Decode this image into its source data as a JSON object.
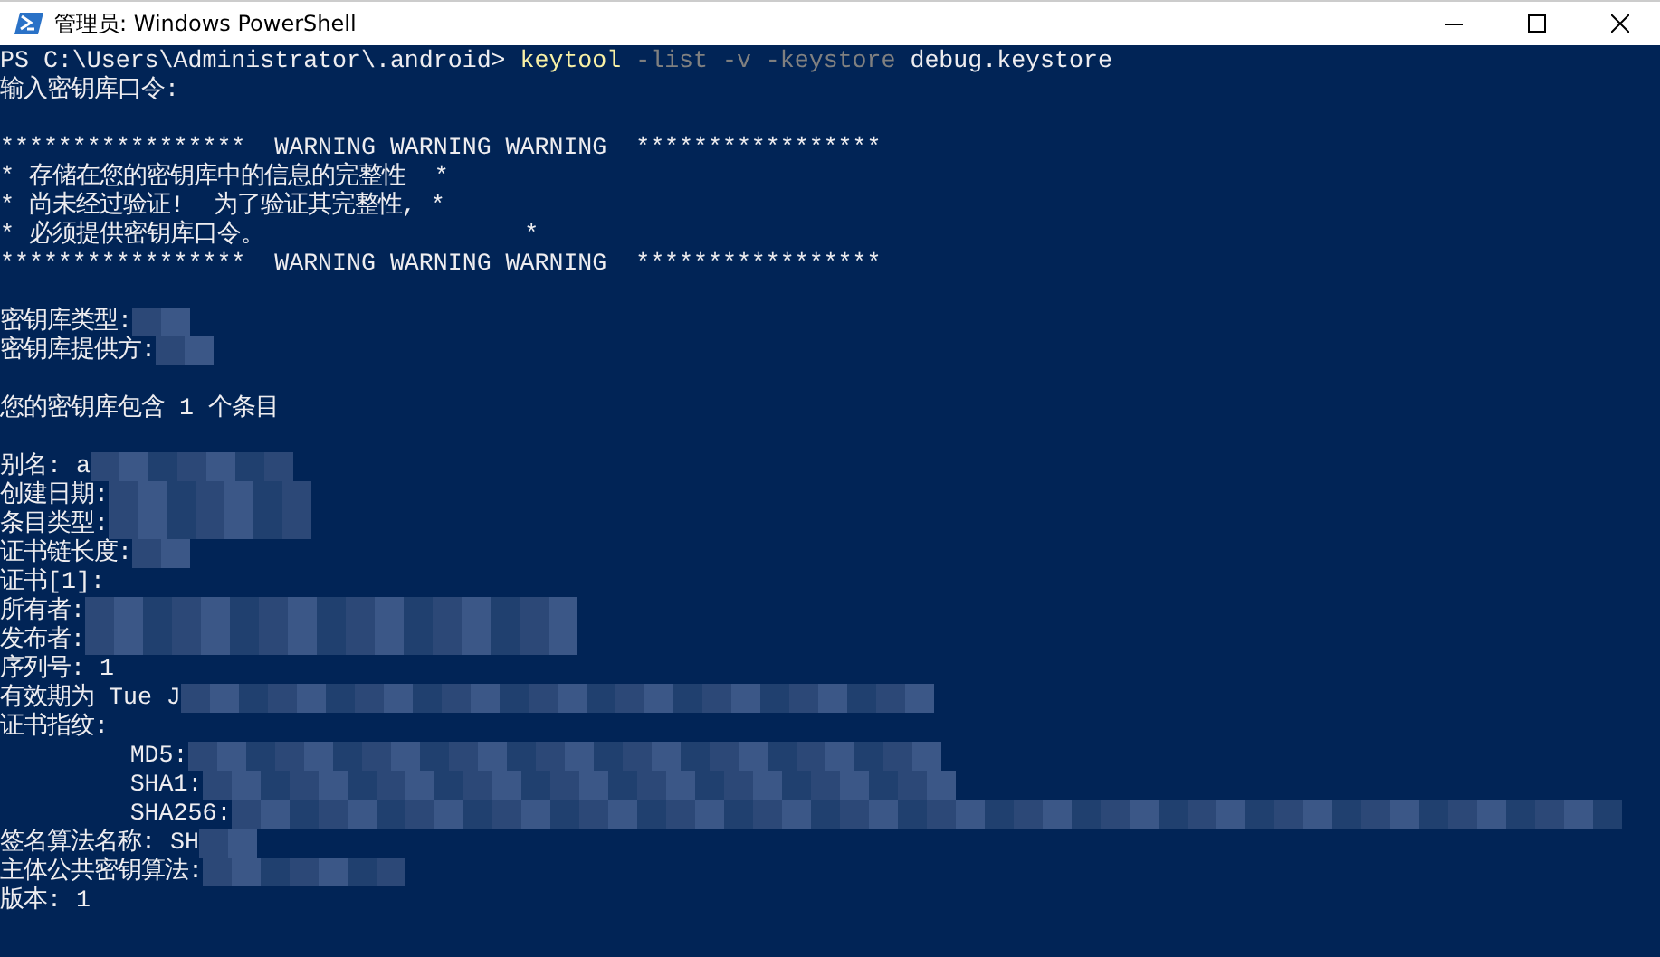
{
  "window": {
    "title": "管理员: Windows PowerShell"
  },
  "console": {
    "lines": [
      {
        "kind": "output",
        "segments": [
          {
            "kind": "prompt",
            "text": "PS C:\\Users\\Administrator\\.android> "
          },
          {
            "kind": "command",
            "text": "keytool"
          },
          {
            "kind": "parameter",
            "text": " -list -v -keystore"
          },
          {
            "kind": "argument",
            "text": " debug.keystore"
          }
        ]
      },
      {
        "kind": "output",
        "segments": [
          {
            "kind": "text",
            "text": "输入密钥库口令:"
          }
        ]
      },
      {
        "kind": "blank"
      },
      {
        "kind": "output",
        "segments": [
          {
            "kind": "text",
            "text": "*****************  WARNING WARNING WARNING  *****************"
          }
        ]
      },
      {
        "kind": "output",
        "segments": [
          {
            "kind": "text",
            "text": "* 存储在您的密钥库中的信息的完整性  *"
          }
        ]
      },
      {
        "kind": "output",
        "segments": [
          {
            "kind": "text",
            "text": "* 尚未经过验证!  为了验证其完整性, *"
          }
        ]
      },
      {
        "kind": "output",
        "segments": [
          {
            "kind": "text",
            "text": "* 必须提供密钥库口令。                  *"
          }
        ]
      },
      {
        "kind": "output",
        "segments": [
          {
            "kind": "text",
            "text": "*****************  WARNING WARNING WARNING  *****************"
          }
        ]
      },
      {
        "kind": "blank"
      },
      {
        "kind": "output",
        "segments": [
          {
            "kind": "text",
            "text": "密钥库类型:"
          },
          {
            "kind": "redacted_s"
          }
        ]
      },
      {
        "kind": "output",
        "segments": [
          {
            "kind": "text",
            "text": "密钥库提供方:"
          },
          {
            "kind": "redacted_s"
          }
        ]
      },
      {
        "kind": "blank"
      },
      {
        "kind": "output",
        "segments": [
          {
            "kind": "text",
            "text": "您的密钥库包含 1 个条目"
          }
        ]
      },
      {
        "kind": "blank"
      },
      {
        "kind": "output",
        "segments": [
          {
            "kind": "text",
            "text": "别名: a"
          },
          {
            "kind": "redacted_m"
          }
        ]
      },
      {
        "kind": "output",
        "segments": [
          {
            "kind": "text",
            "text": "创建日期:"
          },
          {
            "kind": "redacted_m"
          }
        ]
      },
      {
        "kind": "output",
        "segments": [
          {
            "kind": "text",
            "text": "条目类型:"
          },
          {
            "kind": "redacted_m"
          }
        ]
      },
      {
        "kind": "output",
        "segments": [
          {
            "kind": "text",
            "text": "证书链长度:"
          },
          {
            "kind": "redacted_s"
          }
        ]
      },
      {
        "kind": "output",
        "segments": [
          {
            "kind": "text",
            "text": "证书[1]:"
          }
        ]
      },
      {
        "kind": "output",
        "segments": [
          {
            "kind": "text",
            "text": "所有者:"
          },
          {
            "kind": "redacted_l"
          }
        ]
      },
      {
        "kind": "output",
        "segments": [
          {
            "kind": "text",
            "text": "发布者:"
          },
          {
            "kind": "redacted_l"
          }
        ]
      },
      {
        "kind": "output",
        "segments": [
          {
            "kind": "text",
            "text": "序列号: 1"
          }
        ]
      },
      {
        "kind": "output",
        "segments": [
          {
            "kind": "text",
            "text": "有效期为 Tue J"
          },
          {
            "kind": "redacted_xl"
          }
        ]
      },
      {
        "kind": "output",
        "segments": [
          {
            "kind": "text",
            "text": "证书指纹:"
          }
        ]
      },
      {
        "kind": "output",
        "segments": [
          {
            "kind": "text",
            "text": "         MD5:"
          },
          {
            "kind": "redacted_xl"
          }
        ]
      },
      {
        "kind": "output",
        "segments": [
          {
            "kind": "text",
            "text": "         SHA1:"
          },
          {
            "kind": "redacted_xl"
          }
        ]
      },
      {
        "kind": "output",
        "segments": [
          {
            "kind": "text",
            "text": "         SHA256:"
          },
          {
            "kind": "redacted_xxl"
          }
        ]
      },
      {
        "kind": "output",
        "segments": [
          {
            "kind": "text",
            "text": "签名算法名称: SH"
          },
          {
            "kind": "redacted_s"
          }
        ]
      },
      {
        "kind": "output",
        "segments": [
          {
            "kind": "text",
            "text": "主体公共密钥算法:"
          },
          {
            "kind": "redacted_m"
          }
        ]
      },
      {
        "kind": "output",
        "segments": [
          {
            "kind": "text",
            "text": "版本: 1"
          }
        ]
      }
    ]
  }
}
